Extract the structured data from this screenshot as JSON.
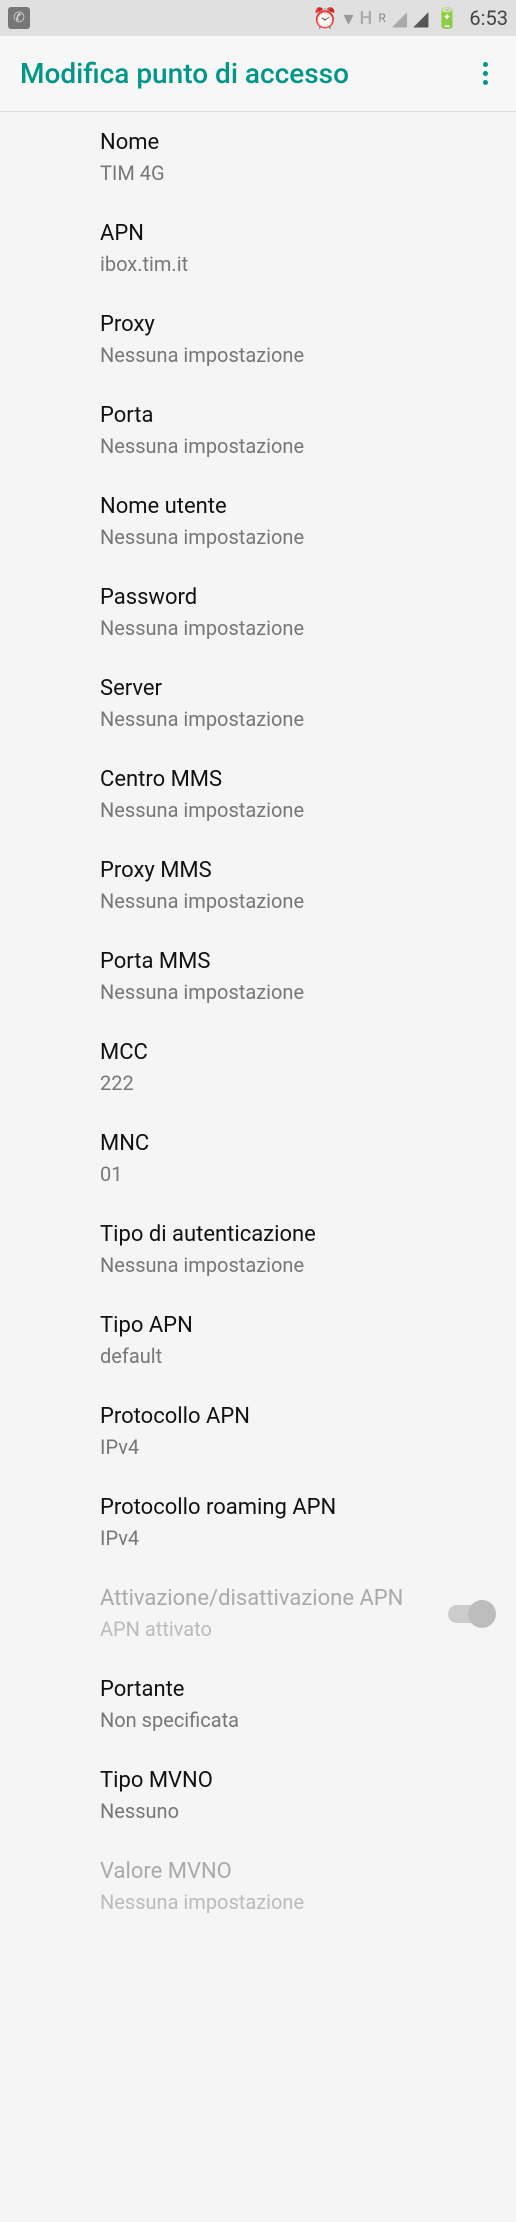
{
  "status": {
    "time": "6:53",
    "alarm": "⏰",
    "wifi": "▾",
    "net": "H",
    "roam": "R",
    "sig1": "◢",
    "sig2": "◢",
    "bat": "🔋"
  },
  "header": {
    "title": "Modifica punto di accesso"
  },
  "settings": [
    {
      "label": "Nome",
      "value": "TIM 4G"
    },
    {
      "label": "APN",
      "value": "ibox.tim.it"
    },
    {
      "label": "Proxy",
      "value": "Nessuna impostazione"
    },
    {
      "label": "Porta",
      "value": "Nessuna impostazione"
    },
    {
      "label": "Nome utente",
      "value": "Nessuna impostazione"
    },
    {
      "label": "Password",
      "value": "Nessuna impostazione"
    },
    {
      "label": "Server",
      "value": "Nessuna impostazione"
    },
    {
      "label": "Centro MMS",
      "value": "Nessuna impostazione"
    },
    {
      "label": "Proxy MMS",
      "value": "Nessuna impostazione"
    },
    {
      "label": "Porta MMS",
      "value": "Nessuna impostazione"
    },
    {
      "label": "MCC",
      "value": "222"
    },
    {
      "label": "MNC",
      "value": "01"
    },
    {
      "label": "Tipo di autenticazione",
      "value": "Nessuna impostazione"
    },
    {
      "label": "Tipo APN",
      "value": "default"
    },
    {
      "label": "Protocollo APN",
      "value": "IPv4"
    },
    {
      "label": "Protocollo roaming APN",
      "value": "IPv4"
    },
    {
      "label": "Attivazione/disattivazione APN",
      "value": "APN attivato",
      "toggle": true,
      "disabled": true
    },
    {
      "label": "Portante",
      "value": "Non specificata"
    },
    {
      "label": "Tipo MVNO",
      "value": "Nessuno"
    },
    {
      "label": "Valore MVNO",
      "value": "Nessuna impostazione",
      "disabled": true
    }
  ]
}
